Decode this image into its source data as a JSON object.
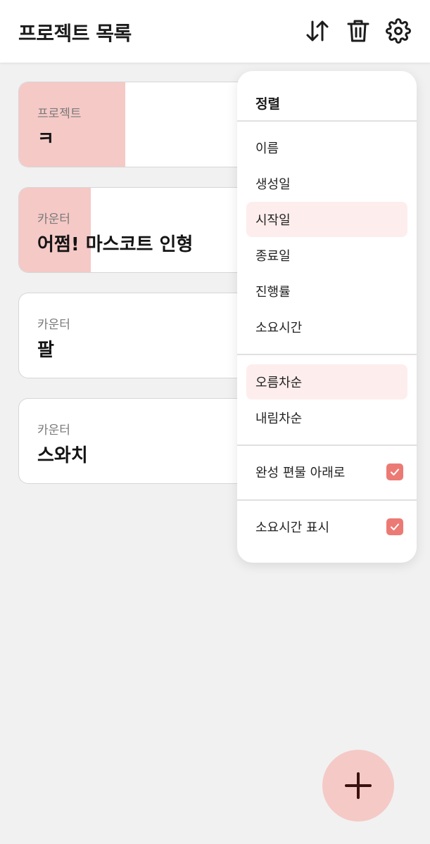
{
  "appbar": {
    "title": "프로젝트 목록",
    "actions": [
      {
        "icon": "sort-icon"
      },
      {
        "icon": "trash-icon"
      },
      {
        "icon": "gear-icon"
      }
    ]
  },
  "projects": [
    {
      "type": "프로젝트",
      "name": "ㅋ",
      "progress": 0.46
    },
    {
      "type": "카운터",
      "name": "어쩜! 마스코트 인형",
      "progress": 0.31
    },
    {
      "type": "카운터",
      "name": "팔",
      "progress": 0
    },
    {
      "type": "카운터",
      "name": "스와치",
      "progress": 0
    }
  ],
  "sort_menu": {
    "title": "정렬",
    "fields": [
      {
        "label": "이름",
        "selected": false
      },
      {
        "label": "생성일",
        "selected": false
      },
      {
        "label": "시작일",
        "selected": true
      },
      {
        "label": "종료일",
        "selected": false
      },
      {
        "label": "진행률",
        "selected": false
      },
      {
        "label": "소요시간",
        "selected": false
      }
    ],
    "orders": [
      {
        "label": "오름차순",
        "selected": true
      },
      {
        "label": "내림차순",
        "selected": false
      }
    ],
    "options": [
      {
        "label": "완성 편물 아래로",
        "checked": true
      },
      {
        "label": "소요시간 표시",
        "checked": true
      }
    ]
  },
  "colors": {
    "accent": "#ec7a74",
    "progress_fill": "#f5c9c6",
    "selected_bg": "#fdeeed"
  },
  "fab": {
    "icon": "plus-icon"
  }
}
